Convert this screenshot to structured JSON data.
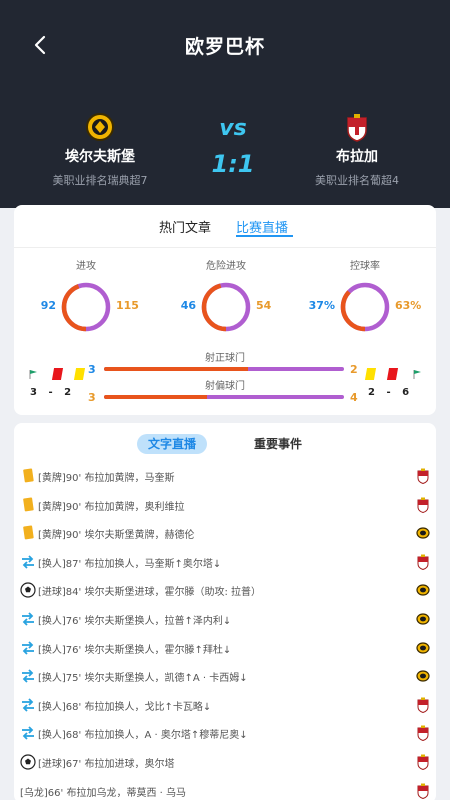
{
  "header": {
    "title": "欧罗巴杯",
    "home": {
      "name": "埃尔夫斯堡",
      "rank": "美职业排名瑞典超7"
    },
    "away": {
      "name": "布拉加",
      "rank": "美职业排名葡超4"
    },
    "vs": "vs",
    "score": "1:1"
  },
  "tabs": {
    "articles": "热门文章",
    "live": "比赛直播"
  },
  "stats": {
    "rings": [
      {
        "label": "进攻",
        "home": "92",
        "away": "115",
        "home_value": 92,
        "away_value": 115
      },
      {
        "label": "危险进攻",
        "home": "46",
        "away": "54",
        "home_value": 46,
        "away_value": 54
      },
      {
        "label": "控球率",
        "home": "37%",
        "away": "63%",
        "home_value": 37,
        "away_value": 63
      }
    ],
    "bars": [
      {
        "label": "射正球门",
        "home": "3",
        "away": "2",
        "home_value": 3,
        "away_value": 2
      },
      {
        "label": "射偏球门",
        "home": "3",
        "away": "4",
        "home_value": 3,
        "away_value": 4
      }
    ],
    "home_mini": {
      "corners": "3",
      "sep": "-",
      "cards": "2"
    },
    "away_mini": {
      "cards": "2",
      "sep": "-",
      "corners": "6"
    }
  },
  "live": {
    "tab_text": "文字直播",
    "tab_events": "重要事件",
    "events": [
      {
        "type": "yellow",
        "team": "away",
        "text": "[黄牌]90' 布拉加黄牌，马奎斯"
      },
      {
        "type": "yellow",
        "team": "away",
        "text": "[黄牌]90' 布拉加黄牌，奥利维拉"
      },
      {
        "type": "yellow",
        "team": "home",
        "text": "[黄牌]90' 埃尔夫斯堡黄牌，赫德伦"
      },
      {
        "type": "sub",
        "team": "away",
        "text": "[换人]87' 布拉加换人，马奎斯↑奥尔塔↓"
      },
      {
        "type": "goal",
        "team": "home",
        "text": "[进球]84' 埃尔夫斯堡进球，霍尔滕（助攻: 拉普）"
      },
      {
        "type": "sub",
        "team": "home",
        "text": "[换人]76' 埃尔夫斯堡换人，拉普↑泽内利↓"
      },
      {
        "type": "sub",
        "team": "home",
        "text": "[换人]76' 埃尔夫斯堡换人，霍尔滕↑拜杜↓"
      },
      {
        "type": "sub",
        "team": "home",
        "text": "[换人]75' 埃尔夫斯堡换人，凯德↑A · 卡西姆↓"
      },
      {
        "type": "sub",
        "team": "away",
        "text": "[换人]68' 布拉加换人，戈比↑卡瓦略↓"
      },
      {
        "type": "sub",
        "team": "away",
        "text": "[换人]68' 布拉加换人，A · 奥尔塔↑穆蒂尼奥↓"
      },
      {
        "type": "goal",
        "team": "away",
        "text": "[进球]67' 布拉加进球，奥尔塔"
      },
      {
        "type": "wulong",
        "team": "away",
        "text": "[乌龙]66' 布拉加乌龙，蒂莫西 · 乌马"
      }
    ]
  },
  "colors": {
    "home": "#1e88e5",
    "away": "#e89a2c",
    "ring_home": "#e8541c",
    "ring_away": "#b05ed0",
    "accent": "#3ec6f0"
  }
}
